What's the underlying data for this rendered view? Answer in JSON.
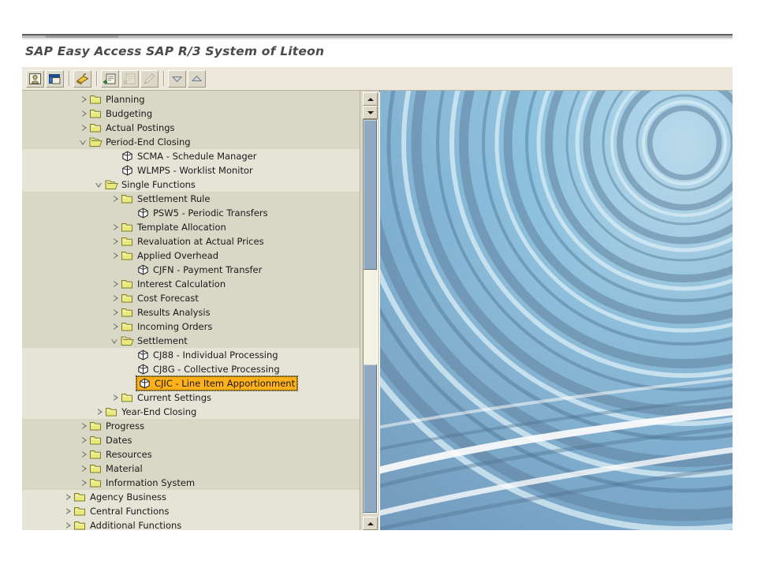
{
  "window": {
    "title": "SAP Easy Access  SAP R/3 System of Liteon",
    "title_part_1": "SAP Easy Access",
    "title_part_2": "SAP R/3 System of Liteon"
  },
  "colors": {
    "panel_background": "#d9d7c6",
    "band_background": "#e6e4d6",
    "toolbar_background": "#ece9dc",
    "selection_highlight": "#ffb01a",
    "folder_icon": "#e8e878",
    "scrollbar_thumb": "#8fa9c0",
    "title_text": "#4a4a4a",
    "water_background": "#7fb4d8"
  },
  "toolbar": {
    "buttons": [
      {
        "name": "create-role-button",
        "icon": "person-window-icon",
        "enabled": true
      },
      {
        "name": "assign-users-button",
        "icon": "blue-window-icon",
        "enabled": true
      },
      {
        "name": "documentation-button",
        "icon": "yellow-book-icon",
        "enabled": true
      },
      {
        "name": "create-favorite-button",
        "icon": "add-note-icon",
        "enabled": true
      },
      {
        "name": "delete-favorite-button",
        "icon": "delete-note-icon",
        "enabled": false
      },
      {
        "name": "change-favorite-button",
        "icon": "pencil-icon",
        "enabled": false
      },
      {
        "name": "move-down-button",
        "icon": "arrow-down-icon",
        "enabled": true
      },
      {
        "name": "move-up-button",
        "icon": "arrow-up-icon",
        "enabled": true
      }
    ],
    "separators_after": [
      1,
      2,
      5
    ]
  },
  "scrollbar": {
    "up_arrow": "▲",
    "down_arrow": "▼",
    "bottom_arrow": "▲",
    "thumb_top_percent": 0,
    "thumb_visible": true
  },
  "tree": {
    "selected_id": "cjic-line-item-apportionment",
    "rows": [
      {
        "id": "planning",
        "label": "Planning",
        "depth": 3,
        "type": "folder",
        "state": "collapsed",
        "band": false
      },
      {
        "id": "budgeting",
        "label": "Budgeting",
        "depth": 3,
        "type": "folder",
        "state": "collapsed",
        "band": false
      },
      {
        "id": "actual-postings",
        "label": "Actual Postings",
        "depth": 3,
        "type": "folder",
        "state": "collapsed",
        "band": false
      },
      {
        "id": "period-end-closing",
        "label": "Period-End Closing",
        "depth": 3,
        "type": "folder-open",
        "state": "expanded",
        "band": false
      },
      {
        "id": "scma-schedule-manager",
        "label": "SCMA - Schedule Manager",
        "depth": 5,
        "type": "transaction",
        "state": "leaf",
        "band": true
      },
      {
        "id": "wlmps-worklist-monitor",
        "label": "WLMPS - Worklist Monitor",
        "depth": 5,
        "type": "transaction",
        "state": "leaf",
        "band": true
      },
      {
        "id": "single-functions",
        "label": "Single Functions",
        "depth": 4,
        "type": "folder-open",
        "state": "expanded",
        "band": true
      },
      {
        "id": "settlement-rule",
        "label": "Settlement Rule",
        "depth": 5,
        "type": "folder",
        "state": "collapsed",
        "band": false
      },
      {
        "id": "psw5-periodic-transfers",
        "label": "PSW5 - Periodic Transfers",
        "depth": 6,
        "type": "transaction",
        "state": "leaf",
        "band": false
      },
      {
        "id": "template-allocation",
        "label": "Template Allocation",
        "depth": 5,
        "type": "folder",
        "state": "collapsed",
        "band": false
      },
      {
        "id": "revaluation-actual-prices",
        "label": "Revaluation at Actual Prices",
        "depth": 5,
        "type": "folder",
        "state": "collapsed",
        "band": false
      },
      {
        "id": "applied-overhead",
        "label": "Applied Overhead",
        "depth": 5,
        "type": "folder",
        "state": "collapsed",
        "band": false
      },
      {
        "id": "cjfn-payment-transfer",
        "label": "CJFN - Payment Transfer",
        "depth": 6,
        "type": "transaction",
        "state": "leaf",
        "band": false
      },
      {
        "id": "interest-calculation",
        "label": "Interest Calculation",
        "depth": 5,
        "type": "folder",
        "state": "collapsed",
        "band": false
      },
      {
        "id": "cost-forecast",
        "label": "Cost Forecast",
        "depth": 5,
        "type": "folder",
        "state": "collapsed",
        "band": false
      },
      {
        "id": "results-analysis",
        "label": "Results Analysis",
        "depth": 5,
        "type": "folder",
        "state": "collapsed",
        "band": false
      },
      {
        "id": "incoming-orders",
        "label": "Incoming Orders",
        "depth": 5,
        "type": "folder",
        "state": "collapsed",
        "band": false
      },
      {
        "id": "settlement",
        "label": "Settlement",
        "depth": 5,
        "type": "folder-open",
        "state": "expanded",
        "band": false
      },
      {
        "id": "cj88-individual-processing",
        "label": "CJ88 - Individual Processing",
        "depth": 6,
        "type": "transaction",
        "state": "leaf",
        "band": true
      },
      {
        "id": "cj8g-collective-processing",
        "label": "CJ8G - Collective Processing",
        "depth": 6,
        "type": "transaction",
        "state": "leaf",
        "band": true
      },
      {
        "id": "cjic-line-item-apportionment",
        "label": "CJIC - Line Item Apportionment",
        "depth": 6,
        "type": "transaction",
        "state": "leaf",
        "band": true
      },
      {
        "id": "current-settings",
        "label": "Current Settings",
        "depth": 5,
        "type": "folder",
        "state": "collapsed",
        "band": true
      },
      {
        "id": "year-end-closing",
        "label": "Year-End Closing",
        "depth": 4,
        "type": "folder",
        "state": "collapsed",
        "band": true
      },
      {
        "id": "progress",
        "label": "Progress",
        "depth": 3,
        "type": "folder",
        "state": "collapsed",
        "band": false
      },
      {
        "id": "dates",
        "label": "Dates",
        "depth": 3,
        "type": "folder",
        "state": "collapsed",
        "band": false
      },
      {
        "id": "resources",
        "label": "Resources",
        "depth": 3,
        "type": "folder",
        "state": "collapsed",
        "band": false
      },
      {
        "id": "material",
        "label": "Material",
        "depth": 3,
        "type": "folder",
        "state": "collapsed",
        "band": false
      },
      {
        "id": "information-system",
        "label": "Information System",
        "depth": 3,
        "type": "folder",
        "state": "collapsed",
        "band": false
      },
      {
        "id": "agency-business",
        "label": "Agency Business",
        "depth": 2,
        "type": "folder",
        "state": "collapsed",
        "band": true
      },
      {
        "id": "central-functions",
        "label": "Central Functions",
        "depth": 2,
        "type": "folder",
        "state": "collapsed",
        "band": true
      },
      {
        "id": "additional-functions",
        "label": "Additional Functions",
        "depth": 2,
        "type": "folder",
        "state": "collapsed",
        "band": true
      }
    ]
  }
}
